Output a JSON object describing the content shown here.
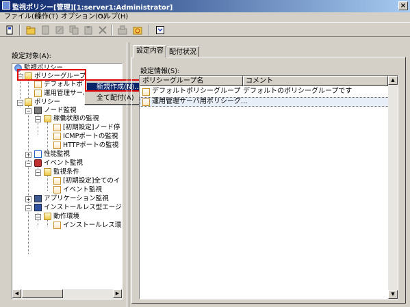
{
  "window": {
    "title": "監視ポリシー[管理][1:server1:Administrator]",
    "close": "×"
  },
  "menu": {
    "items": [
      "ファイル(F)",
      "操作(T)",
      "オプション(O)",
      "ヘルプ(H)"
    ]
  },
  "left": {
    "label": "設定対象(A):",
    "tree": [
      "監視ポリシー",
      "ポリシーグループ",
      "デフォルトポ",
      "運用管理サーバ",
      "ポリシー",
      "ノード監視",
      "稼働状態の監視",
      "[初期設定]ノード停",
      "ICMPポートの監視",
      "HTTPポートの監視",
      "性能監視",
      "イベント監視",
      "監視条件",
      "[初期設定]全てのイ",
      "イベント監視",
      "アプリケーション監視",
      "インストールレス型エージ",
      "動作環境",
      "インストールレス環"
    ]
  },
  "context_menu": {
    "items": [
      "新規作成(N)...",
      "全て配付(A)"
    ]
  },
  "tabs": [
    "設定内容",
    "配付状況"
  ],
  "right": {
    "label": "設定情報(S):",
    "columns": [
      "ポリシーグループ名",
      "コメント"
    ],
    "rows": [
      {
        "name": "デフォルトポリシーグループ",
        "comment": "デフォルトのポリシーグループです"
      },
      {
        "name": "運用管理サーバ用ポリシーグ...",
        "comment": ""
      }
    ]
  },
  "colors": {
    "titlebar": "#0a246a",
    "highlight": "#0a246a",
    "annotation": "#e00000",
    "selected_row": "#e8eef8"
  }
}
